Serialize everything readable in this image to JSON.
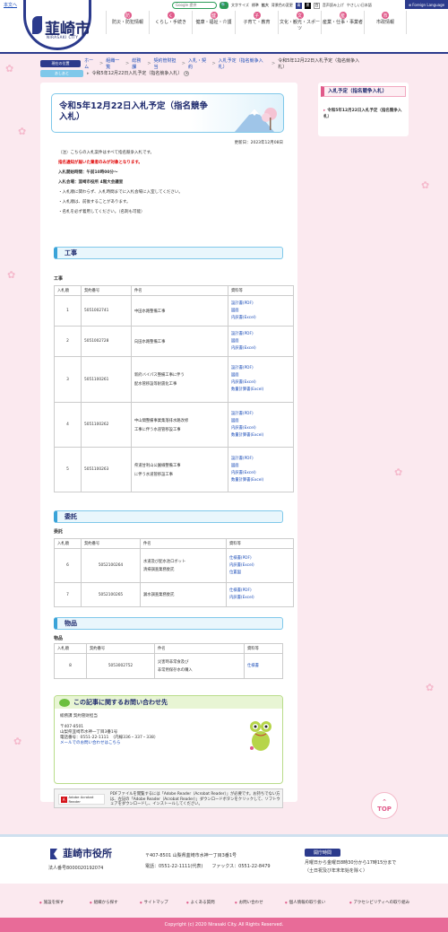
{
  "header": {
    "skip": "本文へ",
    "logo_title": "韮崎市",
    "logo_sub": "NIRASAKI CITY",
    "search_placeholder": "Google 提供",
    "search_btn": "🔍",
    "font_size_label": "文字サイズ",
    "font_std": "標準",
    "font_big": "拡大",
    "bg_color_label": "背景色の変更",
    "bg_options": [
      "青",
      "黒",
      "白"
    ],
    "bg_colors": [
      "#2b3a8c",
      "#000000",
      "#ffffff"
    ],
    "reading": "音声読み上げ",
    "yasashii": "やさしい日本語",
    "foreign": "Foreign Language",
    "nav": [
      {
        "icon": "防",
        "label": "防災・防犯情報"
      },
      {
        "icon": "く",
        "label": "くらし・手続き"
      },
      {
        "icon": "健",
        "label": "健康・福祉・介護"
      },
      {
        "icon": "子",
        "label": "子育て・教育"
      },
      {
        "icon": "文",
        "label": "文化・観光・スポーツ"
      },
      {
        "icon": "産",
        "label": "産業・仕事・事業者"
      },
      {
        "icon": "市",
        "label": "市政情報"
      }
    ]
  },
  "breadcrumb": {
    "current_label": "現在の位置",
    "items": [
      "ホーム",
      "組織一覧",
      "総務課",
      "契約管財担当",
      "入札・契約",
      "入札予定（指名競争入札）"
    ],
    "current": "令和5年12月22日入札予定（指名競争入札）",
    "history_label": "あしあと",
    "history_item": "令和5年12月22日入札予定（指名競争入札）"
  },
  "page": {
    "title": "令和5年12月22日入札予定（指名競争入札）",
    "updated": "更新日：2023年12月08日",
    "notes": [
      "（注）こちらの入札案件はすべて指名競争入札です。",
      "指名通知が届いた業者のみが対象となります。",
      "入札開始時間：午前10時00分～",
      "入札会場：韮崎市役所 4階大会議室",
      "・入札順に関わらず、入札時間までに入札会場に入室してください。",
      "・入札順は、前後することがあります。",
      "・名札を必ず着用してください。（名刺も可能）"
    ]
  },
  "sections": {
    "construction": {
      "title": "工事",
      "sub": "工事",
      "headers": [
        "入札順",
        "契約番号",
        "件名",
        "資料等"
      ],
      "rows": [
        {
          "order": "1",
          "no": "5051002741",
          "name": [
            "中田水路整備工事"
          ],
          "links": [
            "設計書(PDF)",
            "図面",
            "内訳書(Excel)"
          ]
        },
        {
          "order": "2",
          "no": "5051002728",
          "name": [
            "向田水路整備工事"
          ],
          "links": [
            "設計書(PDF)",
            "図面",
            "内訳書(Excel)"
          ]
        },
        {
          "order": "3",
          "no": "5051100261",
          "name": [
            "新府バイパス整備工事に伴う",
            "配水管移設等耐震化工事"
          ],
          "links": [
            "設計書(PDF)",
            "図面",
            "内訳書(Excel)",
            "数量計算書(Excel)"
          ]
        },
        {
          "order": "4",
          "no": "5051100262",
          "name": [
            "中山間整備事業集落排水路改修",
            "工事に伴う水道管移設工事"
          ],
          "links": [
            "設計書(PDF)",
            "図面",
            "内訳書(Excel)",
            "数量計算書(Excel)"
          ]
        },
        {
          "order": "5",
          "no": "5051100263",
          "name": [
            "県道甘利山公園線整備工事",
            "に伴う水道管移設工事"
          ],
          "links": [
            "設計書(PDF)",
            "図面",
            "内訳書(Excel)",
            "数量計算書(Excel)"
          ]
        }
      ]
    },
    "consign": {
      "title": "委託",
      "sub": "委託",
      "headers": [
        "入札順",
        "契約番号",
        "件名",
        "資料等"
      ],
      "rows": [
        {
          "order": "6",
          "no": "5052100264",
          "name": [
            "水道及び配水池ロボット",
            "清掃調査業務委託"
          ],
          "links": [
            "仕様書(PDF)",
            "内訳書(Excel)",
            "位置図"
          ]
        },
        {
          "order": "7",
          "no": "5052100265",
          "name": [
            "漏水調査業務委託"
          ],
          "links": [
            "仕様書(PDF)",
            "内訳書(Excel)"
          ]
        }
      ]
    },
    "goods": {
      "title": "物品",
      "sub": "物品",
      "headers": [
        "入札順",
        "契約番号",
        "件名",
        "資料等"
      ],
      "rows": [
        {
          "order": "8",
          "no": "5053002752",
          "name": [
            "災害時非常食及び",
            "非常用保存水の購入"
          ],
          "links": [
            "仕様書"
          ]
        }
      ]
    }
  },
  "contact": {
    "title": "この記事に関するお問い合わせ先",
    "lines": [
      "総務課 契約管財担当",
      "",
      "〒407-8501",
      "山梨県韮崎市水神一丁目3番1号",
      "電話番号：0551-22-1111　（内線336・337・338）"
    ],
    "mail": "メールでのお問い合わせはこちら"
  },
  "pdf": {
    "badge": "Adobe Acrobat Reader",
    "text": "PDFファイルを閲覧するには「Adobe Reader（Acrobat Reader）」が必要です。お持ちでない方は、左記の「Adobe Reader（Acrobat Reader）」ダウンロードボタンをクリックして、ソフトウェアをダウンロードし、インストールしてください。"
  },
  "sidebar": {
    "title": "入札予定（指名競争入札）",
    "item": "令和5年12月22日入札予定（指名競争入札）"
  },
  "totop": "TOP",
  "footer": {
    "logo": "韮崎市役所",
    "corp": "法人番号8000020192074",
    "address": "〒407-8501 山梨県韮崎市水神一丁目3番1号",
    "tel": "電話：0551-22-1111(代表)　　ファックス：0551-22-8479",
    "hours_tag": "開庁時間",
    "hours1": "月曜日から金曜日8時30分から17時15分まで",
    "hours2": "（土日祝及び年末年始を除く）",
    "links": [
      "施設を探す",
      "組織から探す",
      "サイトマップ",
      "よくある質問",
      "お問い合わせ",
      "個人情報の取り扱い",
      "アクセシビリティへの取り組み"
    ],
    "copyright": "Copyright (c) 2020 Nirasaki City. All Rights Reserved."
  }
}
